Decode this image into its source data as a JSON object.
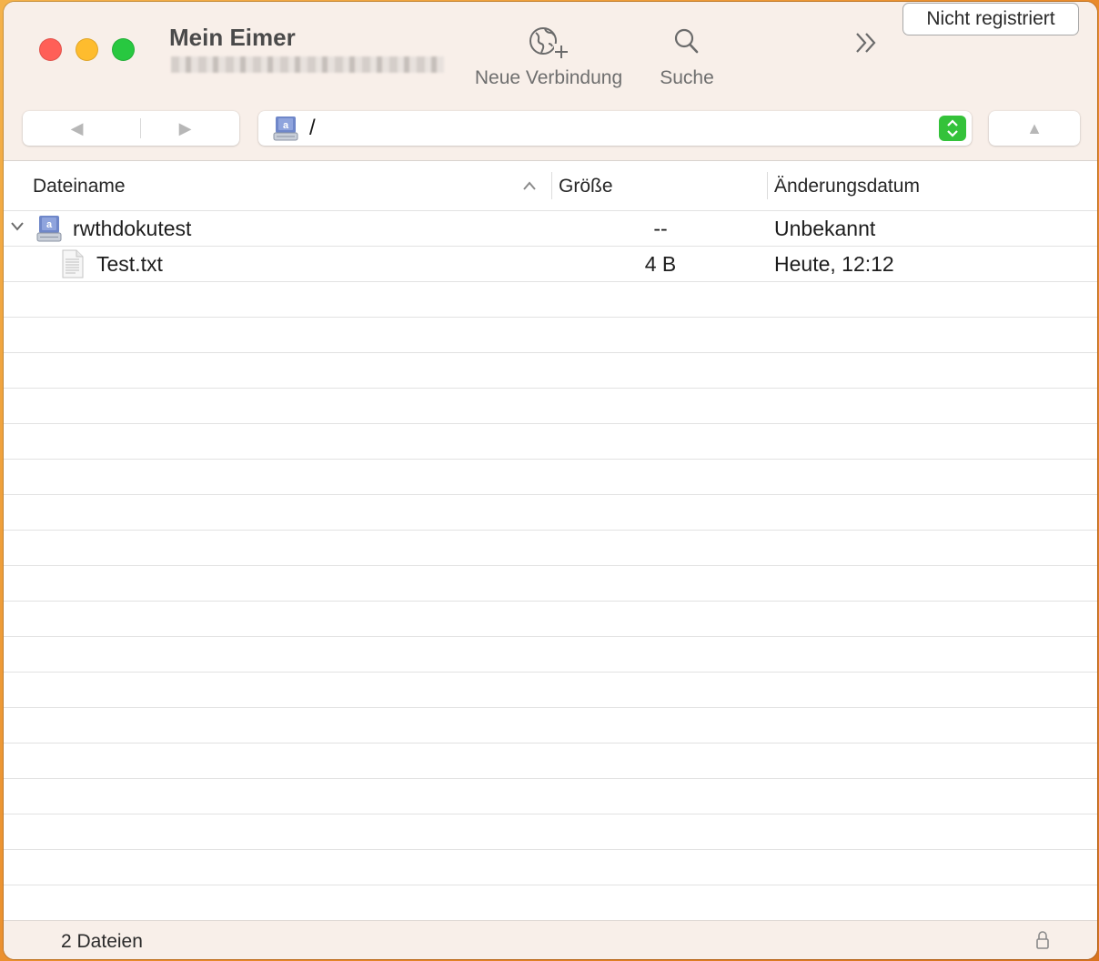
{
  "window": {
    "title": "Mein Eimer"
  },
  "toolbar": {
    "new_connection_label": "Neue Verbindung",
    "search_label": "Suche",
    "registration_label": "Nicht registriert"
  },
  "navigation": {
    "path": "/"
  },
  "columns": {
    "name": "Dateiname",
    "size": "Größe",
    "modified": "Änderungsdatum"
  },
  "files": [
    {
      "name": "rwthdokutest",
      "size": "--",
      "modified": "Unbekannt",
      "kind": "bucket",
      "expanded": true
    },
    {
      "name": "Test.txt",
      "size": "4 B",
      "modified": "Heute, 12:12",
      "kind": "text-file"
    }
  ],
  "status": {
    "count_text": "2 Dateien"
  },
  "colors": {
    "close": "#ff5f57",
    "minimize": "#febc2e",
    "zoom": "#28c840",
    "stepper": "#34c23a",
    "titlebar": "#f8efe9"
  }
}
